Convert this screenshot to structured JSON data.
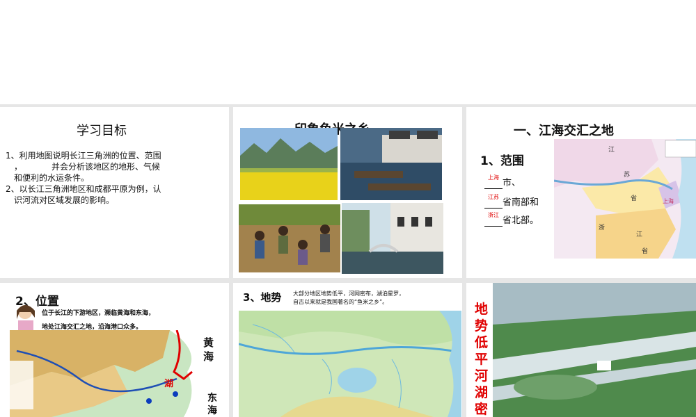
{
  "slides": {
    "goals": {
      "title": "学习目标",
      "item1_line1": "1、利用地图说明长江三角洲的位置、范围",
      "item1_line2": "，　　　　并会分析该地区的地形、气候",
      "item1_line3": "和便利的水运条件。",
      "item2_line1": "2、以长江三角洲地区和成都平原为例，认",
      "item2_line2": "识河流对区域发展的影响。"
    },
    "impression": {
      "title": "印象鱼米之乡"
    },
    "scope": {
      "title": "一、江海交汇之地",
      "subtitle": "1、范围",
      "blank1": "上海",
      "line1": "市、",
      "blank2": "江苏",
      "line2": "省南部和",
      "blank3": "浙江",
      "line3": "省北部。",
      "map_labels": [
        "江",
        "苏",
        "省",
        "浙",
        "江",
        "省",
        "上海"
      ]
    },
    "location": {
      "title": "2、位置",
      "line1": "位于长江的下游地区，濒临黄海和东海，",
      "line2": "地处江海交汇之地，沿海港口众多。",
      "yellow_sea": "黄海",
      "east_sea": "东海",
      "lake_label": "湖"
    },
    "terrain": {
      "title": "3、地势",
      "line1": "大部分地区地势低平，河网密布，湖泊星罗，",
      "line2": "自古以来就是我国著名的“鱼米之乡”。"
    },
    "lowland": {
      "vertical_text": "地势低平河湖密集"
    }
  },
  "colors": {
    "accent_red": "#e00000",
    "band_gray": "#e6e6e6",
    "water_blue": "#9fd3e8"
  }
}
